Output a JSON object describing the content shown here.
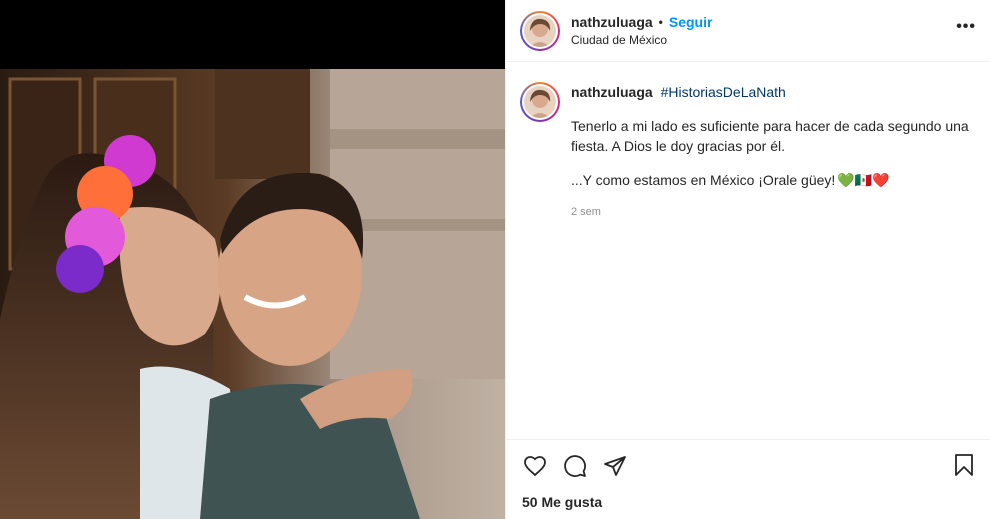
{
  "post": {
    "username": "nathzuluaga",
    "separator": "•",
    "follow_label": "Seguir",
    "location": "Ciudad de México",
    "more_label": "•••"
  },
  "caption": {
    "username": "nathzuluaga",
    "hashtag": "#HistoriasDeLaNath",
    "paragraph1": "Tenerlo a mi lado es suficiente para hacer de cada segundo una fiesta. A Dios le doy gracias por él.",
    "paragraph2": "...Y como estamos en México ¡Orale güey!",
    "emojis": "💚🇲🇽❤️",
    "time": "2 sem"
  },
  "footer": {
    "likes": "50 Me gusta"
  },
  "icons": {
    "like": "heart-icon",
    "comment": "comment-icon",
    "share": "send-icon",
    "save": "bookmark-icon",
    "more": "more-dots-icon"
  },
  "colors": {
    "follow": "#0095f6",
    "hashtag": "#00376b",
    "muted": "#8e8e8e",
    "divider": "#efefef"
  }
}
